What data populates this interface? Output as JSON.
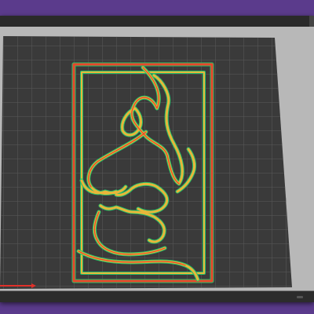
{
  "colors": {
    "desktop": "#5b3b8c",
    "viewport_bg": "#b8b8b8",
    "bed": "#3a3a3a",
    "bed_grid": "#5a5a5a",
    "wall_outer": "#e8452a",
    "wall_inner": "#e8b63a",
    "wall_green": "#23c06a",
    "axis_x": "#e0302a"
  },
  "icons": {
    "status_edge": "resize-grip-icon"
  }
}
